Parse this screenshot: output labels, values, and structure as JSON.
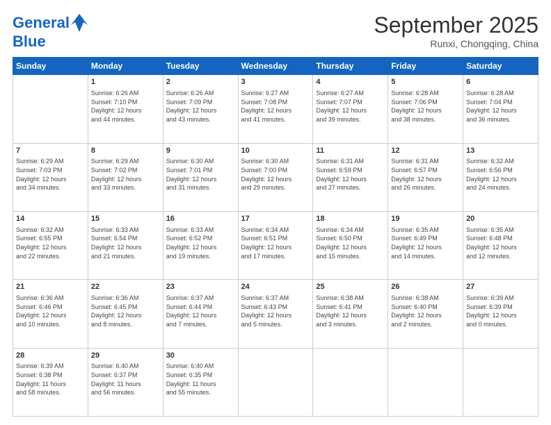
{
  "header": {
    "logo_line1": "General",
    "logo_line2": "Blue",
    "month": "September 2025",
    "location": "Runxi, Chongqing, China"
  },
  "weekdays": [
    "Sunday",
    "Monday",
    "Tuesday",
    "Wednesday",
    "Thursday",
    "Friday",
    "Saturday"
  ],
  "weeks": [
    [
      {
        "day": "",
        "info": ""
      },
      {
        "day": "1",
        "info": "Sunrise: 6:26 AM\nSunset: 7:10 PM\nDaylight: 12 hours\nand 44 minutes."
      },
      {
        "day": "2",
        "info": "Sunrise: 6:26 AM\nSunset: 7:09 PM\nDaylight: 12 hours\nand 43 minutes."
      },
      {
        "day": "3",
        "info": "Sunrise: 6:27 AM\nSunset: 7:08 PM\nDaylight: 12 hours\nand 41 minutes."
      },
      {
        "day": "4",
        "info": "Sunrise: 6:27 AM\nSunset: 7:07 PM\nDaylight: 12 hours\nand 39 minutes."
      },
      {
        "day": "5",
        "info": "Sunrise: 6:28 AM\nSunset: 7:06 PM\nDaylight: 12 hours\nand 38 minutes."
      },
      {
        "day": "6",
        "info": "Sunrise: 6:28 AM\nSunset: 7:04 PM\nDaylight: 12 hours\nand 36 minutes."
      }
    ],
    [
      {
        "day": "7",
        "info": "Sunrise: 6:29 AM\nSunset: 7:03 PM\nDaylight: 12 hours\nand 34 minutes."
      },
      {
        "day": "8",
        "info": "Sunrise: 6:29 AM\nSunset: 7:02 PM\nDaylight: 12 hours\nand 33 minutes."
      },
      {
        "day": "9",
        "info": "Sunrise: 6:30 AM\nSunset: 7:01 PM\nDaylight: 12 hours\nand 31 minutes."
      },
      {
        "day": "10",
        "info": "Sunrise: 6:30 AM\nSunset: 7:00 PM\nDaylight: 12 hours\nand 29 minutes."
      },
      {
        "day": "11",
        "info": "Sunrise: 6:31 AM\nSunset: 6:59 PM\nDaylight: 12 hours\nand 27 minutes."
      },
      {
        "day": "12",
        "info": "Sunrise: 6:31 AM\nSunset: 6:57 PM\nDaylight: 12 hours\nand 26 minutes."
      },
      {
        "day": "13",
        "info": "Sunrise: 6:32 AM\nSunset: 6:56 PM\nDaylight: 12 hours\nand 24 minutes."
      }
    ],
    [
      {
        "day": "14",
        "info": "Sunrise: 6:32 AM\nSunset: 6:55 PM\nDaylight: 12 hours\nand 22 minutes."
      },
      {
        "day": "15",
        "info": "Sunrise: 6:33 AM\nSunset: 6:54 PM\nDaylight: 12 hours\nand 21 minutes."
      },
      {
        "day": "16",
        "info": "Sunrise: 6:33 AM\nSunset: 6:52 PM\nDaylight: 12 hours\nand 19 minutes."
      },
      {
        "day": "17",
        "info": "Sunrise: 6:34 AM\nSunset: 6:51 PM\nDaylight: 12 hours\nand 17 minutes."
      },
      {
        "day": "18",
        "info": "Sunrise: 6:34 AM\nSunset: 6:50 PM\nDaylight: 12 hours\nand 15 minutes."
      },
      {
        "day": "19",
        "info": "Sunrise: 6:35 AM\nSunset: 6:49 PM\nDaylight: 12 hours\nand 14 minutes."
      },
      {
        "day": "20",
        "info": "Sunrise: 6:35 AM\nSunset: 6:48 PM\nDaylight: 12 hours\nand 12 minutes."
      }
    ],
    [
      {
        "day": "21",
        "info": "Sunrise: 6:36 AM\nSunset: 6:46 PM\nDaylight: 12 hours\nand 10 minutes."
      },
      {
        "day": "22",
        "info": "Sunrise: 6:36 AM\nSunset: 6:45 PM\nDaylight: 12 hours\nand 8 minutes."
      },
      {
        "day": "23",
        "info": "Sunrise: 6:37 AM\nSunset: 6:44 PM\nDaylight: 12 hours\nand 7 minutes."
      },
      {
        "day": "24",
        "info": "Sunrise: 6:37 AM\nSunset: 6:43 PM\nDaylight: 12 hours\nand 5 minutes."
      },
      {
        "day": "25",
        "info": "Sunrise: 6:38 AM\nSunset: 6:41 PM\nDaylight: 12 hours\nand 3 minutes."
      },
      {
        "day": "26",
        "info": "Sunrise: 6:38 AM\nSunset: 6:40 PM\nDaylight: 12 hours\nand 2 minutes."
      },
      {
        "day": "27",
        "info": "Sunrise: 6:39 AM\nSunset: 6:39 PM\nDaylight: 12 hours\nand 0 minutes."
      }
    ],
    [
      {
        "day": "28",
        "info": "Sunrise: 6:39 AM\nSunset: 6:38 PM\nDaylight: 11 hours\nand 58 minutes."
      },
      {
        "day": "29",
        "info": "Sunrise: 6:40 AM\nSunset: 6:37 PM\nDaylight: 11 hours\nand 56 minutes."
      },
      {
        "day": "30",
        "info": "Sunrise: 6:40 AM\nSunset: 6:35 PM\nDaylight: 11 hours\nand 55 minutes."
      },
      {
        "day": "",
        "info": ""
      },
      {
        "day": "",
        "info": ""
      },
      {
        "day": "",
        "info": ""
      },
      {
        "day": "",
        "info": ""
      }
    ]
  ]
}
